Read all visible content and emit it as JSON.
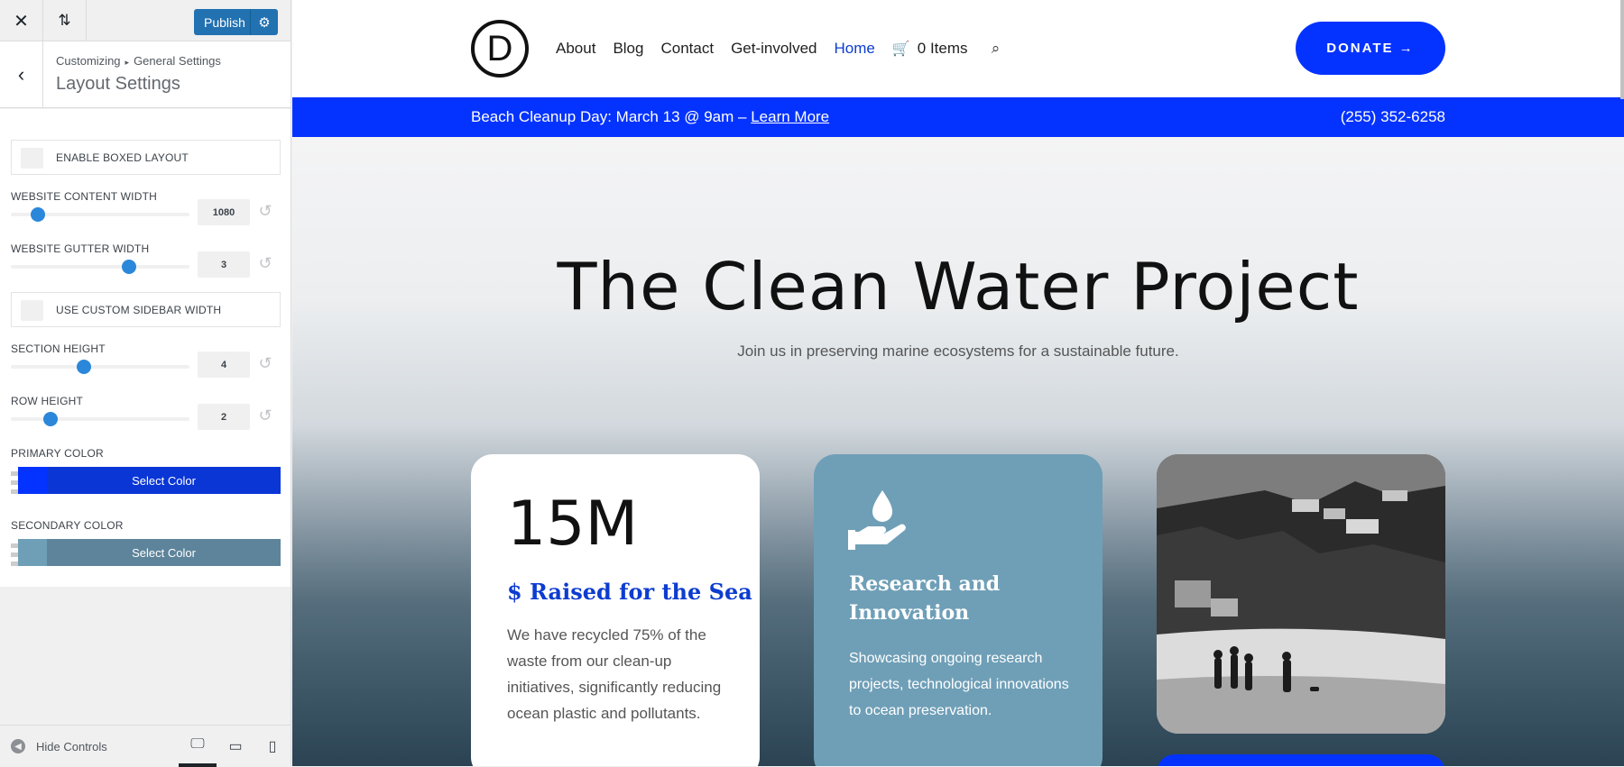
{
  "topbar": {
    "close_icon": "close-icon",
    "device_icon": "sort-arrows-icon",
    "publish_label": "Publish",
    "publish_settings_icon": "gear-icon"
  },
  "section": {
    "breadcrumb_root": "Customizing",
    "breadcrumb_parent": "General Settings",
    "title": "Layout Settings"
  },
  "controls": {
    "boxed_layout_label": "ENABLE BOXED LAYOUT",
    "content_width_label": "WEBSITE CONTENT WIDTH",
    "content_width_value": "1080",
    "content_width_fraction": 0.15,
    "gutter_width_label": "WEBSITE GUTTER WIDTH",
    "gutter_width_value": "3",
    "gutter_width_fraction": 0.66,
    "custom_sidebar_label": "USE CUSTOM SIDEBAR WIDTH",
    "section_height_label": "SECTION HEIGHT",
    "section_height_value": "4",
    "section_height_fraction": 0.41,
    "row_height_label": "ROW HEIGHT",
    "row_height_value": "2",
    "row_height_fraction": 0.22,
    "primary_color_label": "PRIMARY COLOR",
    "primary_color_button": "Select Color",
    "primary_color": "#0433ff",
    "primary_color_btn_bg": "#0a36d6",
    "secondary_color_label": "SECONDARY COLOR",
    "secondary_color_button": "Select Color",
    "secondary_color": "#6f9fb7",
    "secondary_color_btn_bg": "#5d849a"
  },
  "footer": {
    "hide_controls_label": "Hide Controls",
    "devices": [
      "desktop-icon",
      "tablet-icon",
      "mobile-icon"
    ]
  },
  "site": {
    "logo_letter": "D",
    "nav": [
      "About",
      "Blog",
      "Contact",
      "Get-involved",
      "Home"
    ],
    "active_nav": "Home",
    "cart_label": "0 Items",
    "donate_label": "DONATE →",
    "announcement_text": "Beach Cleanup Day: March 13 @ 9am – ",
    "announcement_link": "Learn More",
    "phone": "(255) 352-6258",
    "hero_title": "The Clean Water Project",
    "hero_subtitle": "Join us in preserving marine ecosystems for a sustainable future.",
    "card1": {
      "stat": "15M",
      "heading": "$ Raised for the Sea",
      "body": "We have recycled 75% of the waste from our clean-up initiatives, significantly reducing ocean plastic and pollutants."
    },
    "card2": {
      "icon": "water-drop-hand-icon",
      "heading": "Research and Innovation",
      "body": "Showcasing ongoing research projects, technological innovations to ocean preservation."
    },
    "card3": {
      "image": "beach-people-photo"
    },
    "brand_blue": "#0433ff",
    "accent_blue": "#0d3ccf"
  }
}
